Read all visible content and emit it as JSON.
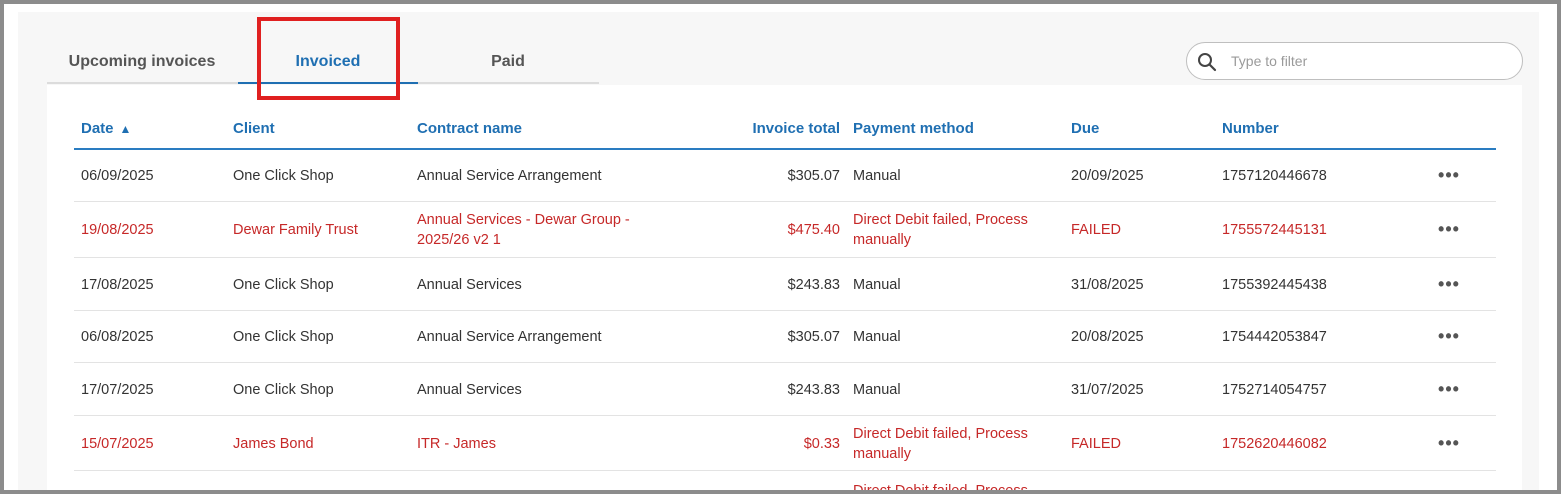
{
  "tabs": [
    {
      "label": "Upcoming invoices"
    },
    {
      "label": "Invoiced"
    },
    {
      "label": "Paid"
    }
  ],
  "filter": {
    "placeholder": "Type to filter",
    "value": ""
  },
  "columns": {
    "date": "Date",
    "client": "Client",
    "contract": "Contract name",
    "total": "Invoice total",
    "payment": "Payment method",
    "due": "Due",
    "number": "Number"
  },
  "sort": {
    "column": "Date",
    "direction": "ascending",
    "icon": "triangle-up-icon"
  },
  "rows": [
    {
      "date": "06/09/2025",
      "client": "One Click Shop",
      "contract": "Annual Service Arrangement",
      "total": "$305.07",
      "payment": "Manual",
      "due": "20/09/2025",
      "number": "1757120446678",
      "status": "normal"
    },
    {
      "date": "19/08/2025",
      "client": "Dewar Family Trust",
      "contract": "Annual Services - Dewar Group - 2025/26 v2 1",
      "total": "$475.40",
      "payment": "Direct Debit failed, Process manually",
      "due": "FAILED",
      "number": "1755572445131",
      "status": "failed"
    },
    {
      "date": "17/08/2025",
      "client": "One Click Shop",
      "contract": "Annual Services",
      "total": "$243.83",
      "payment": "Manual",
      "due": "31/08/2025",
      "number": "1755392445438",
      "status": "normal"
    },
    {
      "date": "06/08/2025",
      "client": "One Click Shop",
      "contract": "Annual Service Arrangement",
      "total": "$305.07",
      "payment": "Manual",
      "due": "20/08/2025",
      "number": "1754442053847",
      "status": "normal"
    },
    {
      "date": "17/07/2025",
      "client": "One Click Shop",
      "contract": "Annual Services",
      "total": "$243.83",
      "payment": "Manual",
      "due": "31/07/2025",
      "number": "1752714054757",
      "status": "normal"
    },
    {
      "date": "15/07/2025",
      "client": "James Bond",
      "contract": "ITR - James",
      "total": "$0.33",
      "payment": "Direct Debit failed, Process manually",
      "due": "FAILED",
      "number": "1752620446082",
      "status": "failed"
    }
  ],
  "partial_row": {
    "payment": "Direct Debit failed, Process"
  },
  "colors": {
    "accent": "#1f6fb2",
    "failed": "#c62828",
    "highlight": "#e02020"
  }
}
